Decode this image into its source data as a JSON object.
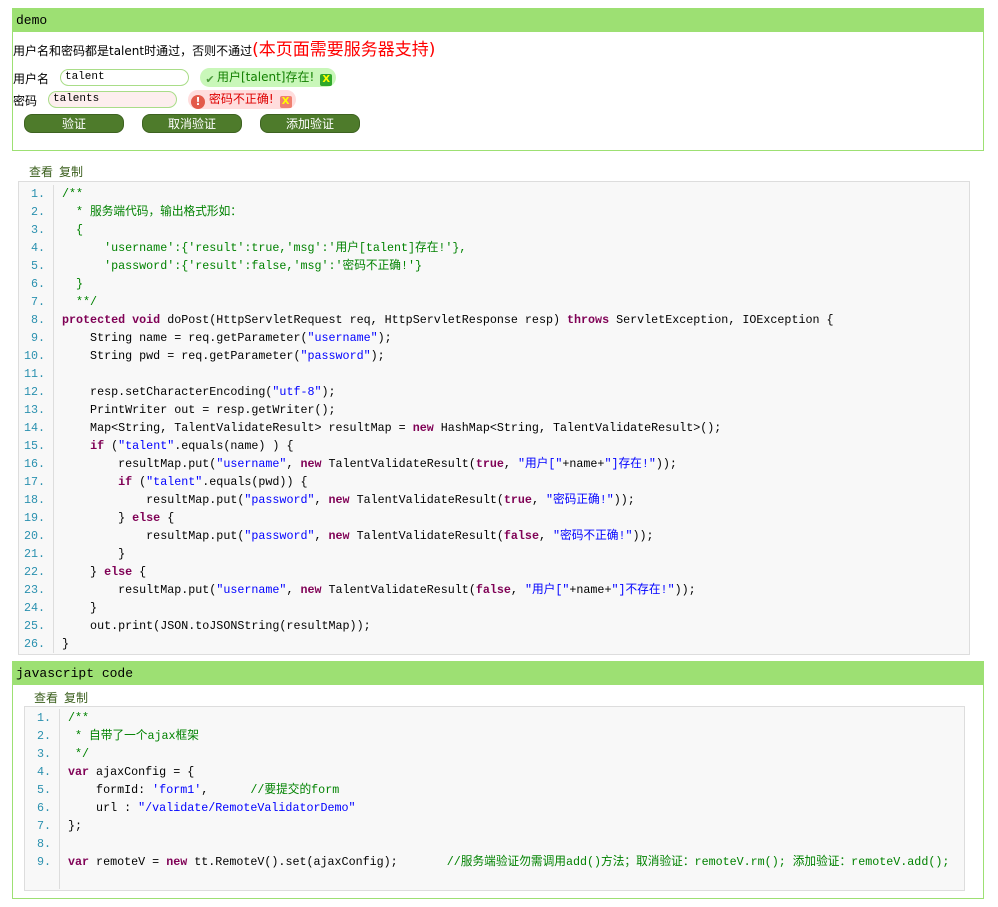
{
  "demo": {
    "title": "demo",
    "intro": "用户名和密码都是talent时通过，否则不通过",
    "intro_note": "(本页面需要服务器支持)",
    "username_label": "用户名",
    "username_value": "talent",
    "username_tip": "用户[talent]存在!",
    "password_label": "密码",
    "password_value": "talents",
    "password_tip": "密码不正确!",
    "buttons": [
      "验证",
      "取消验证",
      "添加验证"
    ],
    "close": "X"
  },
  "toolbar": {
    "view": "查看",
    "copy": "复制"
  },
  "java_code": [
    [
      [
        "c",
        "/**"
      ]
    ],
    [
      [
        "c",
        "  * 服务端代码，输出格式形如："
      ]
    ],
    [
      [
        "c",
        "  {"
      ]
    ],
    [
      [
        "c",
        "      'username':{'result':true,'msg':'用户[talent]存在!'},"
      ]
    ],
    [
      [
        "c",
        "      'password':{'result':false,'msg':'密码不正确!'}"
      ]
    ],
    [
      [
        "c",
        "  }"
      ]
    ],
    [
      [
        "c",
        "  **/"
      ]
    ],
    [
      [
        "k",
        "protected"
      ],
      [
        "p",
        " "
      ],
      [
        "k",
        "void"
      ],
      [
        "p",
        " doPost(HttpServletRequest req, HttpServletResponse resp) "
      ],
      [
        "k",
        "throws"
      ],
      [
        "p",
        " ServletException, IOException {"
      ]
    ],
    [
      [
        "p",
        "    String name = req.getParameter("
      ],
      [
        "s",
        "\"username\""
      ],
      [
        "p",
        ");"
      ]
    ],
    [
      [
        "p",
        "    String pwd = req.getParameter("
      ],
      [
        "s",
        "\"password\""
      ],
      [
        "p",
        ");"
      ]
    ],
    [
      [
        "p",
        " "
      ]
    ],
    [
      [
        "p",
        "    resp.setCharacterEncoding("
      ],
      [
        "s",
        "\"utf-8\""
      ],
      [
        "p",
        ");"
      ]
    ],
    [
      [
        "p",
        "    PrintWriter out = resp.getWriter();"
      ]
    ],
    [
      [
        "p",
        "    Map<String, TalentValidateResult> resultMap = "
      ],
      [
        "k",
        "new"
      ],
      [
        "p",
        " HashMap<String, TalentValidateResult>();"
      ]
    ],
    [
      [
        "p",
        "    "
      ],
      [
        "k",
        "if"
      ],
      [
        "p",
        " ("
      ],
      [
        "s",
        "\"talent\""
      ],
      [
        "p",
        ".equals(name) ) {"
      ]
    ],
    [
      [
        "p",
        "        resultMap.put("
      ],
      [
        "s",
        "\"username\""
      ],
      [
        "p",
        ", "
      ],
      [
        "k",
        "new"
      ],
      [
        "p",
        " TalentValidateResult("
      ],
      [
        "k",
        "true"
      ],
      [
        "p",
        ", "
      ],
      [
        "s",
        "\"用户[\""
      ],
      [
        "p",
        "+name+"
      ],
      [
        "s",
        "\"]存在!\""
      ],
      [
        "p",
        "));"
      ]
    ],
    [
      [
        "p",
        "        "
      ],
      [
        "k",
        "if"
      ],
      [
        "p",
        " ("
      ],
      [
        "s",
        "\"talent\""
      ],
      [
        "p",
        ".equals(pwd)) {"
      ]
    ],
    [
      [
        "p",
        "            resultMap.put("
      ],
      [
        "s",
        "\"password\""
      ],
      [
        "p",
        ", "
      ],
      [
        "k",
        "new"
      ],
      [
        "p",
        " TalentValidateResult("
      ],
      [
        "k",
        "true"
      ],
      [
        "p",
        ", "
      ],
      [
        "s",
        "\"密码正确!\""
      ],
      [
        "p",
        "));"
      ]
    ],
    [
      [
        "p",
        "        } "
      ],
      [
        "k",
        "else"
      ],
      [
        "p",
        " {"
      ]
    ],
    [
      [
        "p",
        "            resultMap.put("
      ],
      [
        "s",
        "\"password\""
      ],
      [
        "p",
        ", "
      ],
      [
        "k",
        "new"
      ],
      [
        "p",
        " TalentValidateResult("
      ],
      [
        "k",
        "false"
      ],
      [
        "p",
        ", "
      ],
      [
        "s",
        "\"密码不正确!\""
      ],
      [
        "p",
        "));"
      ]
    ],
    [
      [
        "p",
        "        }"
      ]
    ],
    [
      [
        "p",
        "    } "
      ],
      [
        "k",
        "else"
      ],
      [
        "p",
        " {"
      ]
    ],
    [
      [
        "p",
        "        resultMap.put("
      ],
      [
        "s",
        "\"username\""
      ],
      [
        "p",
        ", "
      ],
      [
        "k",
        "new"
      ],
      [
        "p",
        " TalentValidateResult("
      ],
      [
        "k",
        "false"
      ],
      [
        "p",
        ", "
      ],
      [
        "s",
        "\"用户[\""
      ],
      [
        "p",
        "+name+"
      ],
      [
        "s",
        "\"]不存在!\""
      ],
      [
        "p",
        "));"
      ]
    ],
    [
      [
        "p",
        "    }"
      ]
    ],
    [
      [
        "p",
        "    out.print(JSON.toJSONString(resultMap));"
      ]
    ],
    [
      [
        "p",
        "}"
      ]
    ]
  ],
  "js": {
    "title": "javascript code"
  },
  "js_code": [
    [
      [
        "c",
        "/**"
      ]
    ],
    [
      [
        "c",
        " * 自带了一个ajax框架"
      ]
    ],
    [
      [
        "c",
        " */"
      ]
    ],
    [
      [
        "k",
        "var"
      ],
      [
        "p",
        " ajaxConfig = {"
      ]
    ],
    [
      [
        "p",
        "    formId: "
      ],
      [
        "s",
        "'form1'"
      ],
      [
        "p",
        ",      "
      ],
      [
        "c",
        "//要提交的form"
      ]
    ],
    [
      [
        "p",
        "    url : "
      ],
      [
        "s",
        "\"/validate/RemoteValidatorDemo\""
      ]
    ],
    [
      [
        "p",
        "};"
      ]
    ],
    [
      [
        "p",
        " "
      ]
    ],
    [
      [
        "k",
        "var"
      ],
      [
        "p",
        " remoteV = "
      ],
      [
        "k",
        "new"
      ],
      [
        "p",
        " tt.RemoteV().set(ajaxConfig);       "
      ],
      [
        "c",
        "//服务端验证勿需调用add()方法；取消验证：remoteV.rm(); 添加验证：remoteV.add();"
      ]
    ]
  ]
}
